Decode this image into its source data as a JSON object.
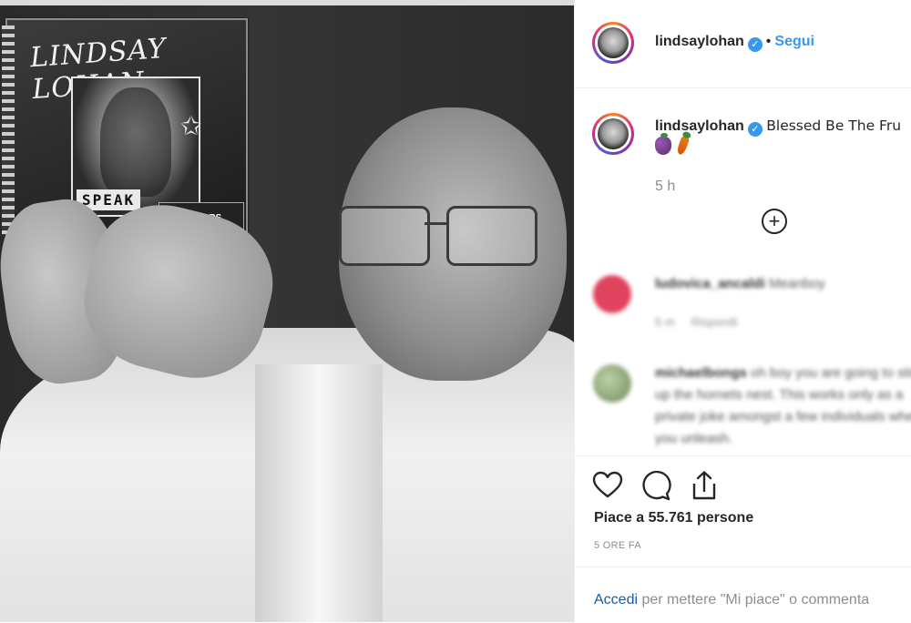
{
  "post": {
    "username": "lindsaylohan",
    "follow_separator": "•",
    "follow_label": "Segui",
    "caption_text": "Blessed Be The Fru",
    "caption_emojis": [
      "grapes-emoji",
      "carrot-emoji"
    ],
    "caption_time": "5 h",
    "photo_cd_title": "LINDSAY LOHAN",
    "photo_cd_speak": "SPEAK",
    "photo_cd_rumors": "RUMORS"
  },
  "comments": [
    {
      "username": "ludovica_ancaldi",
      "text": "Meanboy",
      "time": "5 m",
      "reply": "Rispondi",
      "avatar_color": "#e0435e"
    },
    {
      "username": "michaelbongs",
      "text": "oh boy you are going to stir up the hornets nest. This works only as a private joke amongst a few individuals when you unleash.",
      "avatar_color": "#7a9a6a"
    }
  ],
  "actions": {
    "likes_text": "Piace a 55.761 persone",
    "timestamp": "5 ORE FA"
  },
  "login": {
    "link": "Accedi",
    "rest": " per mettere \"Mi piace\" o commenta"
  },
  "colors": {
    "link_blue": "#3897f0",
    "muted": "#8e8e8e",
    "text": "#262626"
  }
}
